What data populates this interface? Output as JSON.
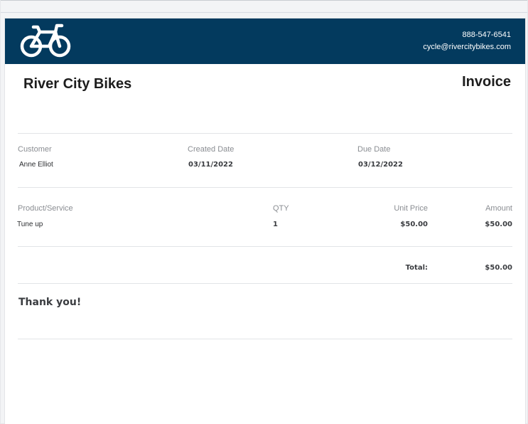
{
  "company": {
    "name": "River City Bikes",
    "phone": "888-547-6541",
    "email": "cycle@rivercitybikes.com",
    "logo_icon": "bicycle-icon"
  },
  "document": {
    "title": "Invoice"
  },
  "info": {
    "customer_label": "Customer",
    "customer_value": "Anne Elliot",
    "created_label": "Created Date",
    "created_value": "03/11/2022",
    "due_label": "Due Date",
    "due_value": "03/12/2022"
  },
  "items": {
    "headers": [
      "Product/Service",
      "QTY",
      "Unit Price",
      "Amount"
    ],
    "rows": [
      {
        "product": "Tune up",
        "qty": "1",
        "unit_price": "$50.00",
        "amount": "$50.00"
      }
    ]
  },
  "total": {
    "label": "Total:",
    "value": "$50.00"
  },
  "footer": {
    "message": "Thank you!"
  },
  "colors": {
    "banner": "#033a5e",
    "text": "#1d1d1d",
    "muted": "#8a8d92"
  }
}
